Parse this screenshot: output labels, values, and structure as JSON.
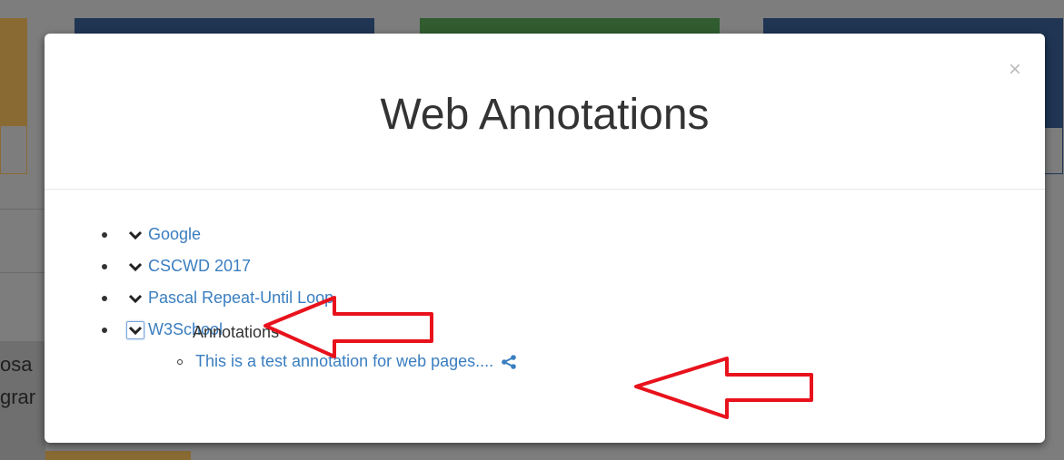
{
  "modal": {
    "title": "Web Annotations",
    "close_label": "×"
  },
  "tree": {
    "items": [
      {
        "label": "Google",
        "icon": "chevron-down-icon"
      },
      {
        "label": "CSCWD 2017",
        "icon": "chevron-down-icon"
      },
      {
        "label": "Pascal Repeat-Until Loop",
        "icon": "chevron-down-icon"
      },
      {
        "label": "W3School",
        "icon": "chevron-down-icon",
        "expanded": true
      }
    ],
    "annotations_label": "Annotations",
    "annotation_item": {
      "label": "This is a test annotation for web pages....",
      "icon": "share-icon"
    }
  },
  "background": {
    "text_line1": "osa",
    "text_line2": "grar"
  },
  "colors": {
    "link": "#3a7ec0",
    "arrow": "#e8121c",
    "overlay": "#7d7d7d"
  }
}
